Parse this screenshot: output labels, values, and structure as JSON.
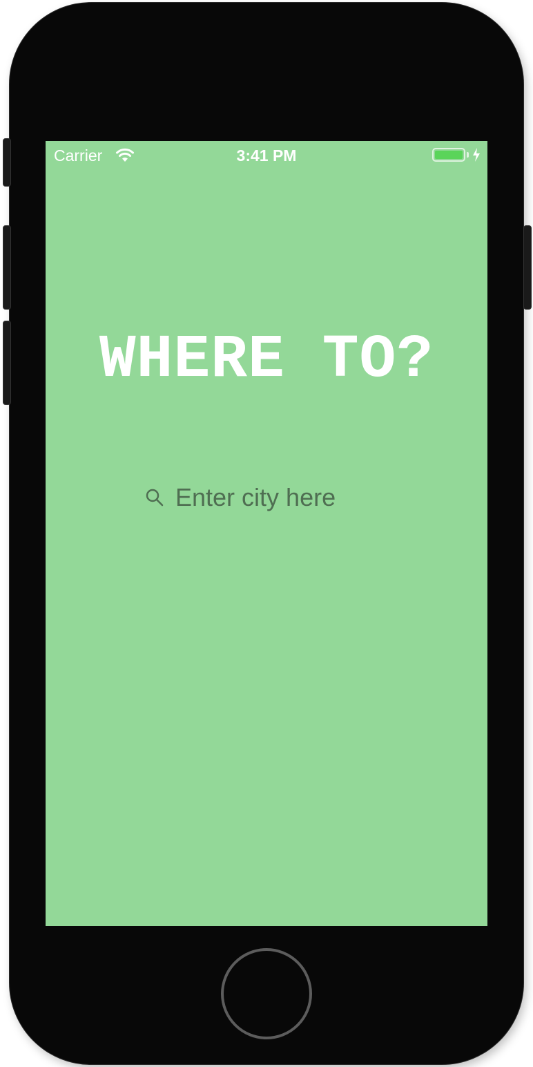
{
  "status_bar": {
    "carrier": "Carrier",
    "time": "3:41 PM",
    "wifi_icon": "wifi-icon",
    "battery_icon": "battery-icon",
    "charging_icon": "charging-bolt-icon"
  },
  "main": {
    "title": "WHERE TO?",
    "search": {
      "placeholder": "Enter city here",
      "value": "",
      "icon": "search-icon"
    }
  },
  "colors": {
    "screen_background": "#93d898",
    "title_text": "#ffffff",
    "placeholder_text": "#4f6e52",
    "device_body": "#080808"
  }
}
